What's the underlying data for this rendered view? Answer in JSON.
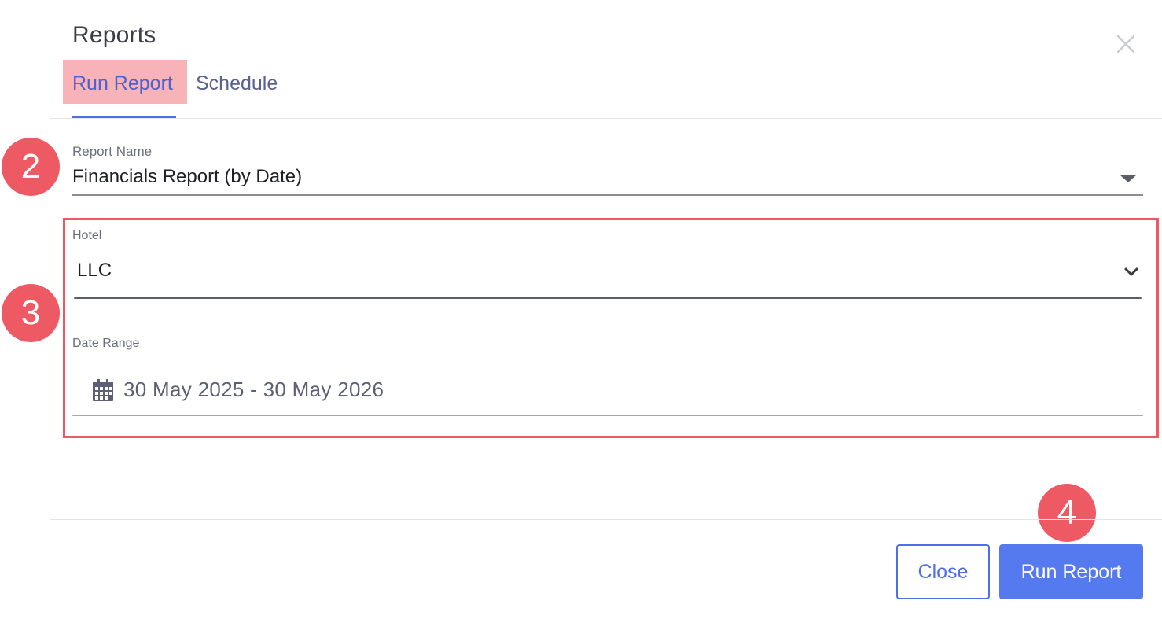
{
  "dialog": {
    "title": "Reports"
  },
  "tabs": [
    {
      "label": "Run Report",
      "active": true
    },
    {
      "label": "Schedule",
      "active": false
    }
  ],
  "steps": [
    "2",
    "3",
    "4"
  ],
  "report_name": {
    "label": "Report Name",
    "value": "Financials Report (by Date)"
  },
  "hotel": {
    "label": "Hotel",
    "value": "LLC"
  },
  "date_range": {
    "label": "Date Range",
    "value": "30 May 2025 - 30 May 2026"
  },
  "footer": {
    "close_label": "Close",
    "run_label": "Run Report"
  },
  "icons": {
    "close": "close-icon",
    "report_caret": "caret-down-icon",
    "hotel_chevron": "chevron-down-icon",
    "date": "calendar-icon"
  },
  "colors": {
    "accent": "#4f6ee8",
    "primary_button": "#5579ef",
    "annotation": "#ee5a63",
    "tab_highlight": "#f7b3b8"
  }
}
